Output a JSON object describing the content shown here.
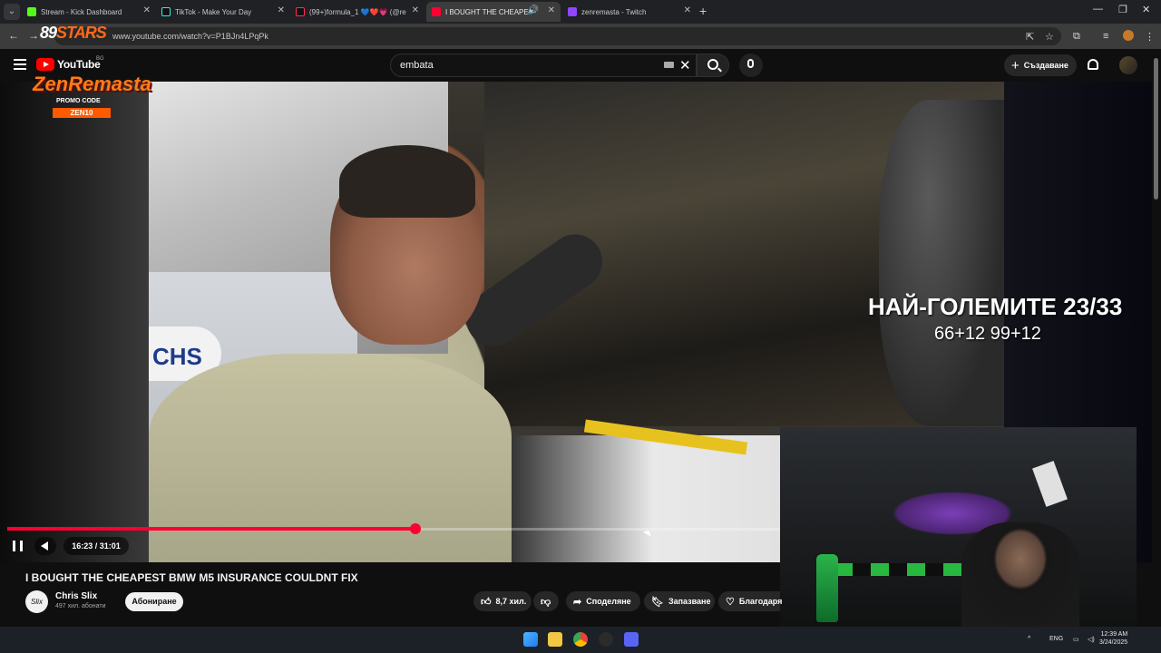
{
  "browser": {
    "tabs": [
      {
        "label": "Stream - Kick Dashboard",
        "color": "#53fc18",
        "active": false
      },
      {
        "label": "TikTok - Make Your Day",
        "color": "#111111",
        "active": false
      },
      {
        "label": "(99+)formula_1 💙❤️💗 (@re",
        "color": "#111111",
        "active": false
      },
      {
        "label": "I BOUGHT THE CHEAPEST B",
        "color": "#ff0033",
        "active": true
      },
      {
        "label": "zenremasta - Twitch",
        "color": "#9146ff",
        "active": false
      }
    ],
    "url": "www.youtube.com/watch?v=P1BJn4LPqPk"
  },
  "youtube": {
    "logo_text": "YouTube",
    "region": "BG",
    "search_value": "embata",
    "create_label": "Създаване"
  },
  "overlay": {
    "stars_logo": "89",
    "stars_word": "STARS",
    "brand": "ZenRemasta",
    "promo_label": "PROMO CODE",
    "promo_code": "ZEN10",
    "headline": "НАЙ-ГОЛЕМИТЕ 23/33",
    "subline": "66+12 99+12"
  },
  "player": {
    "time": "16:23 / 31:01",
    "progress": 0.528,
    "frame_logo_text": "CHS"
  },
  "video": {
    "title": "I BOUGHT THE CHEAPEST BMW M5 INSURANCE COULDNT FIX",
    "channel": "Chris Slix",
    "subscribers": "497 хил. абонати",
    "subscribe_label": "Абониране",
    "likes": "8,7 хил.",
    "share_label": "Споделяне",
    "save_label": "Запазване",
    "thanks_label": "Благодаря"
  },
  "taskbar": {
    "lang": "ENG",
    "time": "12:39 AM",
    "date": "3/24/2025"
  },
  "colors": {
    "accent": "#ff0033",
    "background": "#0f0f0f"
  }
}
